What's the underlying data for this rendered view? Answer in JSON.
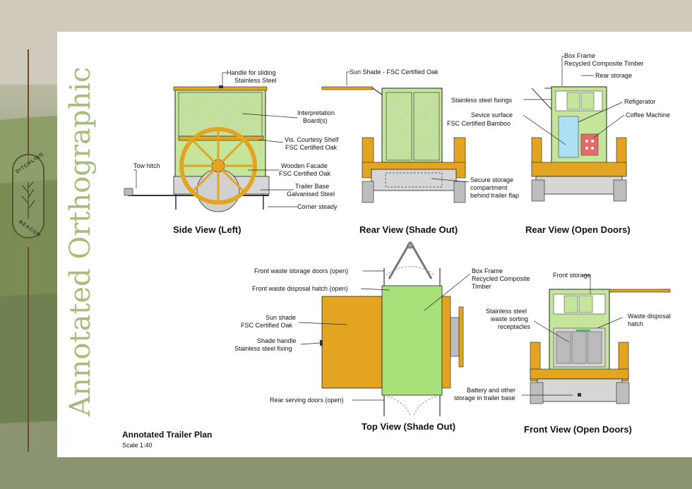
{
  "vertical_title": "Annotated Orthographic",
  "badge": {
    "top": "DITCHLING",
    "bottom": "BEACON"
  },
  "plan": {
    "title": "Annotated Trailer Plan",
    "scale": "Scale 1:40"
  },
  "view_titles": {
    "side": "Side View (Left)",
    "rear_shade": "Rear View (Shade Out)",
    "rear_open": "Rear View (Open Doors)",
    "top": "Top View (Shade Out)",
    "front": "Front View (Open Doors)"
  },
  "side_labels": {
    "handle1": "Handle for sliding",
    "handle2": "Stainless Steel",
    "interp1": "Interpretation",
    "interp2": "Board(s)",
    "shelf1": "Vis. Courtesy Shelf",
    "shelf2": "FSC Certified Oak",
    "tow": "Tow hitch",
    "facade1": "Wooden Facade",
    "facade2": "FSC Certified Oak",
    "base1": "Trailer Base",
    "base2": "Galvanised Steel",
    "corner": "Corner steady"
  },
  "rear_shade_labels": {
    "sunshade": "Sun Shade - FSC Certified Oak",
    "fix": "Stainless steel fixings",
    "surf1": "Sevice surface",
    "surf2": "FSC Certified Bamboo",
    "sec1": "Secure storage",
    "sec2": "compartment",
    "sec3": "behind trailer flap"
  },
  "rear_open_labels": {
    "box1": "Box Frame",
    "box2": "Recycled Composite Timber",
    "rearstore": "Rear storage",
    "fridge": "Refigerator",
    "coffee": "Coffee Machine"
  },
  "top_labels": {
    "fw_doors": "Front waste storage doors (open)",
    "fw_hatch": "Front waste disposal hatch (open)",
    "sun1": "Sun shade",
    "sun2": "FSC Certified Oak",
    "handle1": "Shade handle",
    "handle2": "Stainless steel fixing",
    "rear_doors": "Rear serving doors (open)",
    "box1": "Box Frame",
    "box2": "Recycled Composite",
    "box3": "Timber"
  },
  "front_labels": {
    "frontstore": "Front storage",
    "sort1": "Stainless steel",
    "sort2": "waste sorting",
    "sort3": "receptacles",
    "waste1": "Waste disposal",
    "waste2": "hatch",
    "batt1": "Battery and other",
    "batt2": "storage in trailer base"
  },
  "colors": {
    "frame_green": "#c5e59a",
    "oak": "#e3a520",
    "steel": "#d6d6d6",
    "title_green": "#a9bc7c"
  }
}
